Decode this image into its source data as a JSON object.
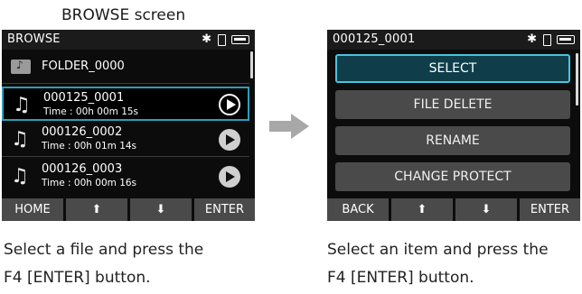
{
  "top_caption": "BROWSE screen",
  "left": {
    "title": "BROWSE",
    "status_icons": [
      "bluetooth-icon",
      "sd-card-icon",
      "battery-icon"
    ],
    "items": [
      {
        "type": "folder",
        "label": "FOLDER_0000"
      },
      {
        "type": "file",
        "name": "000125_0001",
        "time": "Time : 00h 00m 15s",
        "selected": true
      },
      {
        "type": "file",
        "name": "000126_0002",
        "time": "Time : 00h 01m 14s"
      },
      {
        "type": "file",
        "name": "000126_0003",
        "time": "Time : 00h 00m 16s"
      }
    ],
    "fkeys": [
      "HOME",
      "⬆",
      "⬇",
      "ENTER"
    ],
    "caption": [
      "Select a file and press the",
      "F4 [ENTER] button."
    ]
  },
  "right": {
    "title": "000125_0001",
    "menu": [
      "SELECT",
      "FILE DELETE",
      "RENAME",
      "CHANGE PROTECT"
    ],
    "selected_menu": "SELECT",
    "fkeys": [
      "BACK",
      "⬆",
      "⬇",
      "ENTER"
    ],
    "caption": [
      "Select an item and press the",
      "F4 [ENTER] button."
    ]
  },
  "colors": {
    "highlight": "#2aa0b8",
    "menu_active": "#0f3e4a",
    "screen_bg": "#0c0c0c",
    "key_bg": "#4a4a4a"
  }
}
